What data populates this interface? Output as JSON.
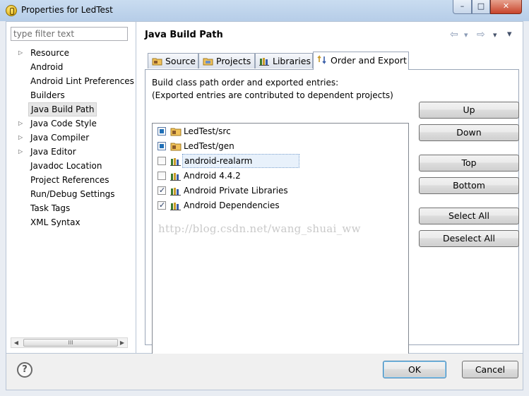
{
  "window": {
    "title": "Properties for LedTest",
    "minimize": "–",
    "maximize": "□",
    "close": "✕"
  },
  "filter": {
    "placeholder": "type filter text"
  },
  "tree": {
    "items": [
      {
        "label": "Resource",
        "expandable": true
      },
      {
        "label": "Android",
        "expandable": false
      },
      {
        "label": "Android Lint Preferences",
        "expandable": false
      },
      {
        "label": "Builders",
        "expandable": false
      },
      {
        "label": "Java Build Path",
        "expandable": false,
        "selected": true
      },
      {
        "label": "Java Code Style",
        "expandable": true
      },
      {
        "label": "Java Compiler",
        "expandable": true
      },
      {
        "label": "Java Editor",
        "expandable": true
      },
      {
        "label": "Javadoc Location",
        "expandable": false
      },
      {
        "label": "Project References",
        "expandable": false
      },
      {
        "label": "Run/Debug Settings",
        "expandable": false
      },
      {
        "label": "Task Tags",
        "expandable": false
      },
      {
        "label": "XML Syntax",
        "expandable": false
      }
    ],
    "scroll_grip": "III"
  },
  "page": {
    "title": "Java Build Path",
    "back": "⇦",
    "forward": "⇨",
    "dropdown": "▾"
  },
  "tabs": [
    {
      "label": "Source",
      "icon": "source-folder-icon"
    },
    {
      "label": "Projects",
      "icon": "projects-icon"
    },
    {
      "label": "Libraries",
      "icon": "libraries-icon"
    },
    {
      "label": "Order and Export",
      "icon": "order-export-icon",
      "active": true
    }
  ],
  "order_export": {
    "line1": "Build class path order and exported entries:",
    "line2": "(Exported entries are contributed to dependent projects)",
    "entries": [
      {
        "label": "LedTest/src",
        "state": "fixed",
        "icon": "source-folder-icon"
      },
      {
        "label": "LedTest/gen",
        "state": "fixed",
        "icon": "source-folder-icon"
      },
      {
        "label": "android-realarm",
        "state": "unchecked",
        "icon": "library-icon",
        "focused": true
      },
      {
        "label": "Android 4.4.2",
        "state": "unchecked",
        "icon": "library-icon"
      },
      {
        "label": "Android Private Libraries",
        "state": "checked",
        "icon": "library-icon"
      },
      {
        "label": "Android Dependencies",
        "state": "checked",
        "icon": "library-icon"
      }
    ],
    "buttons": {
      "up": "Up",
      "down": "Down",
      "top": "Top",
      "bottom": "Bottom",
      "select_all": "Select All",
      "deselect_all": "Deselect All"
    },
    "watermark": "http://blog.csdn.net/wang_shuai_ww"
  },
  "footer": {
    "help": "?",
    "ok": "OK",
    "cancel": "Cancel"
  }
}
